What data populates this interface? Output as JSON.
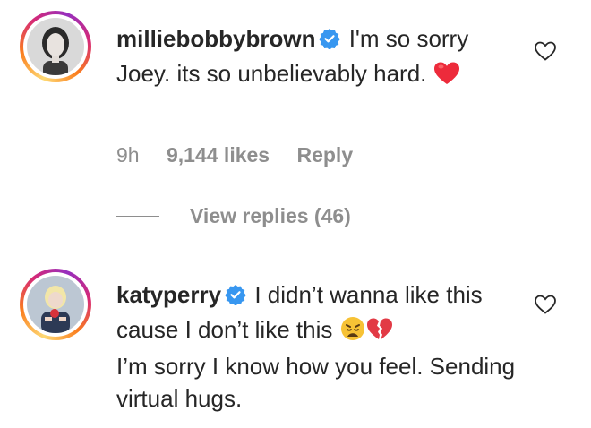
{
  "comments": [
    {
      "username": "milliebobbybrown",
      "verified": true,
      "text": "I'm so sorry Joey. its so unbelievably hard.",
      "emoji": "red-heart",
      "time": "9h",
      "likes": "9,144 likes",
      "reply_label": "Reply",
      "view_replies": "View replies (46)"
    },
    {
      "username": "katyperry",
      "verified": true,
      "text_part1": "I didn’t wanna like this cause I don’t like this",
      "emoji": [
        "weary-face",
        "broken-heart"
      ],
      "text_part2": "I’m sorry I know how you feel. Sending virtual hugs."
    }
  ],
  "colors": {
    "text": "#262626",
    "muted": "#8e8e8e",
    "verified": "#3897f0",
    "heart": "#ed2b3b"
  }
}
